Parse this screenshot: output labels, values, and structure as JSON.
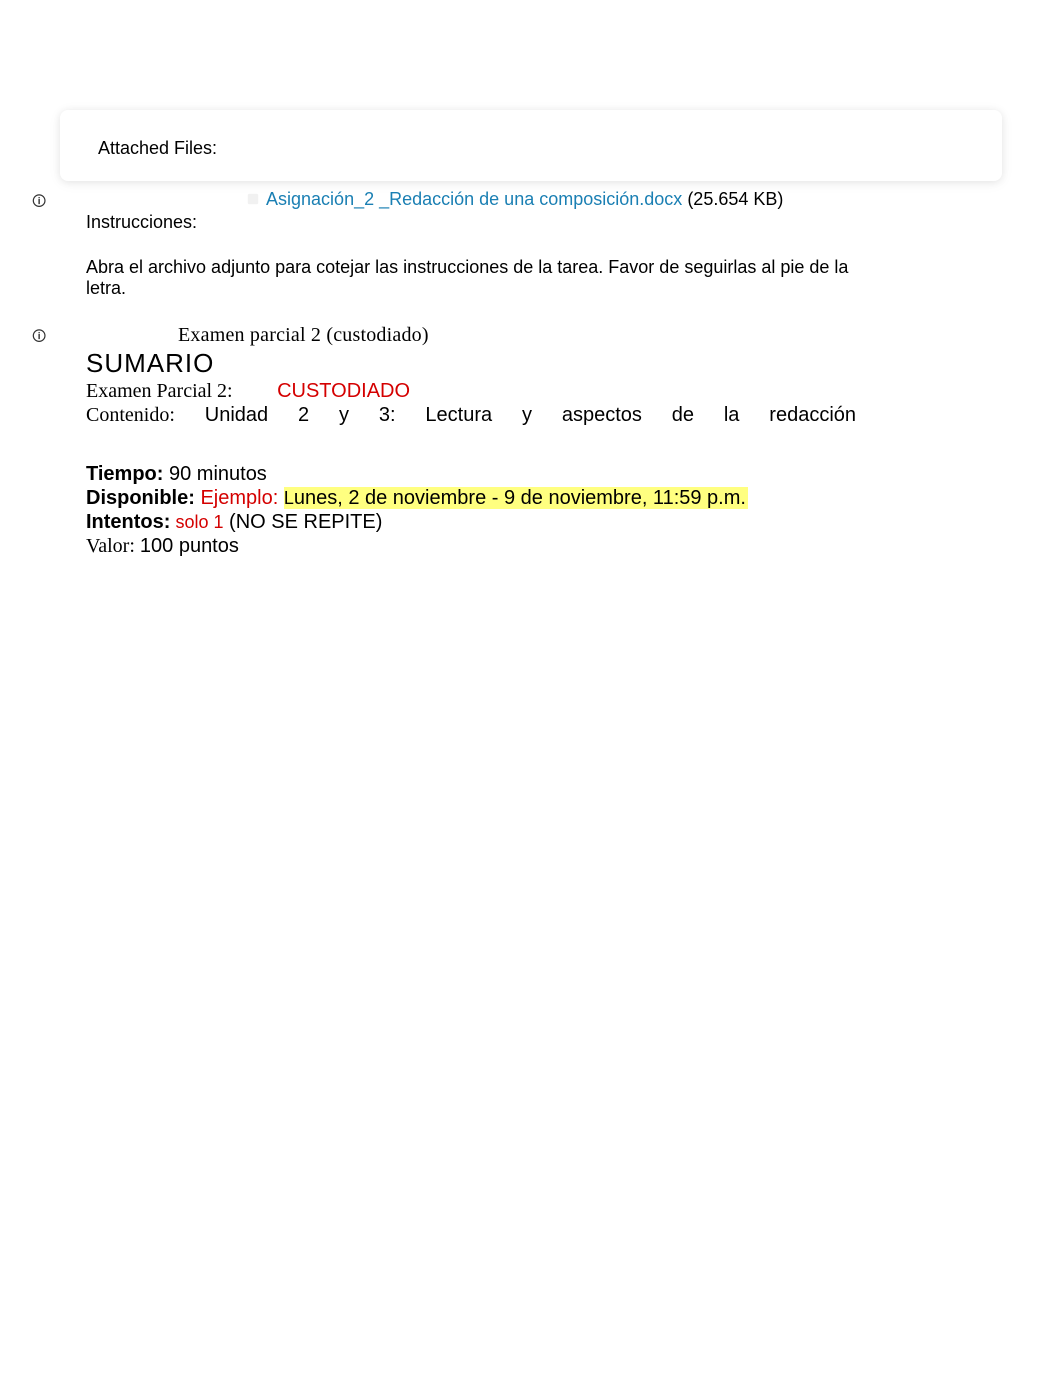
{
  "attached": {
    "label": "Attached Files:",
    "file_name": "Asignación_2 _Redacción de una composición.docx",
    "file_size": "(25.654 KB)"
  },
  "instructions": {
    "label": "Instrucciones:",
    "body": "Abra el archivo adjunto para cotejar las instrucciones de la tarea. Favor de seguirlas al pie de la letra."
  },
  "exam": {
    "title": "Examen parcial 2 (custodiado)"
  },
  "summary": {
    "heading": "SUMARIO",
    "exam_label": "Examen Parcial 2:",
    "custodiado": "CUSTODIADO",
    "contenido_label": "Contenido:",
    "contenido_value": "Unidad 2 y 3: Lectura y aspectos de la redacción"
  },
  "meta": {
    "tiempo_label": "Tiempo:",
    "tiempo_value": " 90 minutos",
    "disponible_label": "Disponible:",
    "ejemplo_label": " Ejemplo: ",
    "disponible_value_start": "L",
    "disponible_value_rest": "unes, 2  de noviembre - 9 de noviembre, 11:59 p.m.   ",
    "intentos_label": "Intentos:",
    "intentos_value": " solo 1",
    "intentos_note": " (NO SE REPITE)",
    "valor_label": "Valor:    ",
    "valor_value": "100 puntos"
  },
  "icons": {
    "marker": "🛈",
    "attach": "📎"
  }
}
